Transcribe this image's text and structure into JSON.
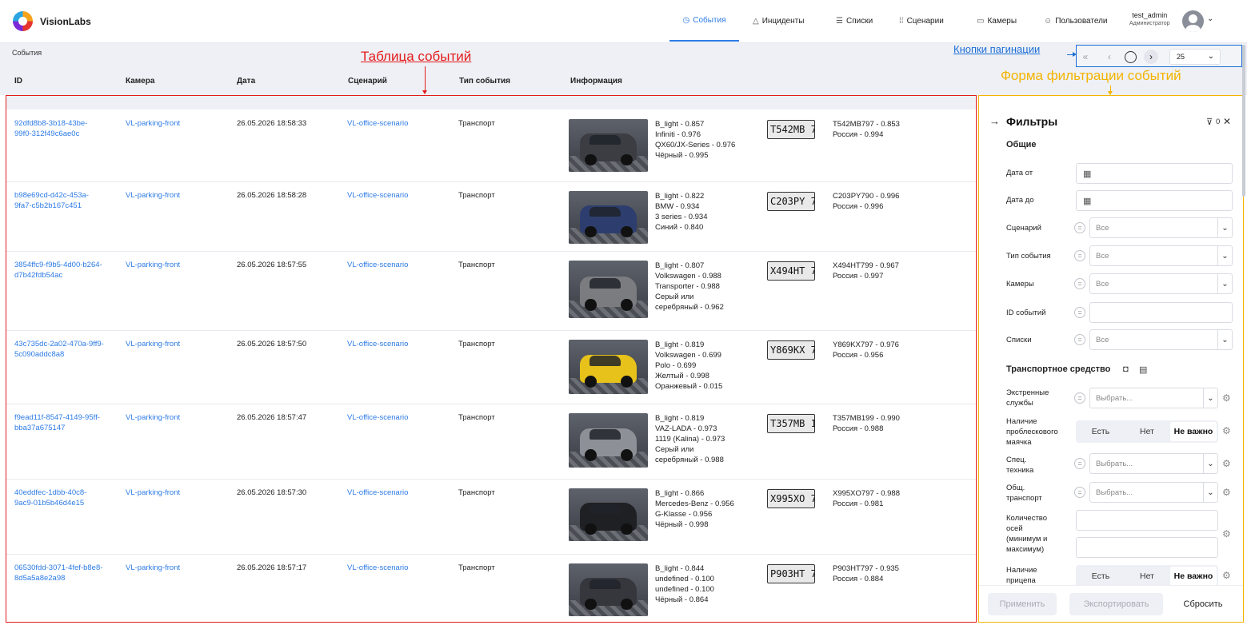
{
  "header": {
    "brand": "VisionLabs",
    "nav": [
      {
        "label": "События",
        "icon": "clock-icon",
        "active": true
      },
      {
        "label": "Инциденты",
        "icon": "warning-icon",
        "active": false
      },
      {
        "label": "Списки",
        "icon": "list-icon",
        "active": false
      },
      {
        "label": "Сценарии",
        "icon": "scenario-icon",
        "active": false
      },
      {
        "label": "Камеры",
        "icon": "camera-icon",
        "active": false
      },
      {
        "label": "Пользователи",
        "icon": "users-icon",
        "active": false
      }
    ],
    "user": {
      "name": "test_admin",
      "role": "Администратор"
    }
  },
  "breadcrumb": "События",
  "annotations": {
    "table": "Таблица событий",
    "pagination": "Кнопки пагинации",
    "filters": "Форма фильтрации событий"
  },
  "pagination": {
    "page_size": "25"
  },
  "table": {
    "columns": [
      "ID",
      "Камера",
      "Дата",
      "Сценарий",
      "Тип события",
      "Информация"
    ],
    "rows": [
      {
        "id": "92dfd8b8-3b18-43be-99f0-312f49c6ae0c",
        "camera": "VL-parking-front",
        "date": "26.05.2026 18:58:33",
        "scenario": "VL-office-scenario",
        "type": "Транспорт",
        "attrs": [
          "B_light - 0.857",
          "Infiniti - 0.976",
          "QX60/JX-Series - 0.976",
          "Чёрный - 0.995"
        ],
        "plate_img": "T542MB 799",
        "plate": [
          "T542MB797 - 0.853",
          "Россия - 0.994"
        ],
        "car_color": "#3b3d42"
      },
      {
        "id": "b98e69cd-d42c-453a-9fa7-c5b2b167c451",
        "camera": "VL-parking-front",
        "date": "26.05.2026 18:58:28",
        "scenario": "VL-office-scenario",
        "type": "Транспорт",
        "attrs": [
          "B_light - 0.822",
          "BMW - 0.934",
          "3 series - 0.934",
          "Синий - 0.840"
        ],
        "plate_img": "C203PY 790",
        "plate": [
          "C203PY790 - 0.996",
          "Россия - 0.996"
        ],
        "car_color": "#2d3e6e"
      },
      {
        "id": "3854ffc9-f9b5-4d00-b264-d7b42fdb54ac",
        "camera": "VL-parking-front",
        "date": "26.05.2026 18:57:55",
        "scenario": "VL-office-scenario",
        "type": "Транспорт",
        "attrs": [
          "B_light - 0.807",
          "Volkswagen - 0.988",
          "Transporter - 0.988",
          "Серый или",
          "серебряный - 0.962"
        ],
        "plate_img": "X494HT 799",
        "plate": [
          "X494HT799 - 0.967",
          "Россия - 0.997"
        ],
        "car_color": "#7a7c80"
      },
      {
        "id": "43c735dc-2a02-470a-9ff9-5c090addc8a8",
        "camera": "VL-parking-front",
        "date": "26.05.2026 18:57:50",
        "scenario": "VL-office-scenario",
        "type": "Транспорт",
        "attrs": [
          "B_light - 0.819",
          "Volkswagen - 0.699",
          "Polo - 0.699",
          "Желтый - 0.998",
          "Оранжевый - 0.015"
        ],
        "plate_img": "Y869KX 797",
        "plate": [
          "Y869KX797 - 0.976",
          "Россия - 0.956"
        ],
        "car_color": "#e6c21a"
      },
      {
        "id": "f9ead11f-8547-4149-95ff-bba37a675147",
        "camera": "VL-parking-front",
        "date": "26.05.2026 18:57:47",
        "scenario": "VL-office-scenario",
        "type": "Транспорт",
        "attrs": [
          "B_light - 0.819",
          "VAZ-LADA - 0.973",
          "1119 (Kalina) - 0.973",
          "Серый или",
          "серебряный - 0.988"
        ],
        "plate_img": "T357MB 199",
        "plate": [
          "T357MB199 - 0.990",
          "Россия - 0.988"
        ],
        "car_color": "#8d9096"
      },
      {
        "id": "40eddfec-1dbb-40c8-9ac9-01b5b46d4e15",
        "camera": "VL-parking-front",
        "date": "26.05.2026 18:57:30",
        "scenario": "VL-office-scenario",
        "type": "Транспорт",
        "attrs": [
          "B_light - 0.866",
          "Mercedes-Benz - 0.956",
          "G-Klasse - 0.956",
          "Чёрный - 0.998"
        ],
        "plate_img": "X995XO 797",
        "plate": [
          "X995XO797 - 0.988",
          "Россия - 0.981"
        ],
        "car_color": "#1f2024"
      },
      {
        "id": "06530fdd-3071-4fef-b8e8-8d5a5a8e2a98",
        "camera": "VL-parking-front",
        "date": "26.05.2026 18:57:17",
        "scenario": "VL-office-scenario",
        "type": "Транспорт",
        "attrs": [
          "B_light - 0.844",
          "undefined - 0.100",
          "undefined - 0.100",
          "Чёрный - 0.864"
        ],
        "plate_img": "P903HT 797",
        "plate": [
          "P903HT797 - 0.935",
          "Россия - 0.884"
        ],
        "car_color": "#35373c"
      }
    ]
  },
  "filters": {
    "title": "Фильтры",
    "count": "0",
    "general": "Общие",
    "date_from": "Дата от",
    "date_to": "Дата до",
    "scenario": "Сценарий",
    "event_type": "Тип события",
    "cameras": "Камеры",
    "event_ids": "ID событий",
    "lists": "Списки",
    "all": "Все",
    "vehicle": "Транспортное средство",
    "emergency_l1": "Экстренные",
    "emergency_l2": "службы",
    "beacon_l1": "Наличие",
    "beacon_l2": "проблескового",
    "beacon_l3": "маячка",
    "special_l1": "Спец.",
    "special_l2": "техника",
    "public_l1": "Общ.",
    "public_l2": "транспорт",
    "axles_l1": "Количество",
    "axles_l2": "осей",
    "axles_l3": "(минимум и",
    "axles_l4": "максимум)",
    "trailer_l1": "Наличие",
    "trailer_l2": "прицепа",
    "choose": "Выбрать...",
    "yes": "Есть",
    "no": "Нет",
    "any": "Не важно",
    "apply": "Применить",
    "export": "Экспортировать",
    "reset": "Сбросить"
  }
}
